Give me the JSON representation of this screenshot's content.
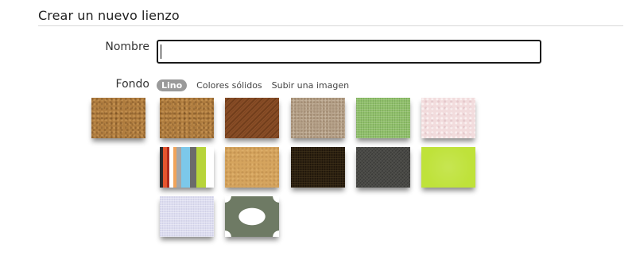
{
  "page": {
    "title": "Crear un nuevo lienzo"
  },
  "form": {
    "name_label": "Nombre",
    "name_value": "",
    "background_label": "Fondo"
  },
  "tabs": [
    {
      "label": "Lino",
      "active": true
    },
    {
      "label": "Colores sólidos",
      "active": false
    },
    {
      "label": "Subir una imagen",
      "active": false
    }
  ],
  "selected_texture": "cork",
  "textures": [
    {
      "name": "cork",
      "color": "#b07d3f"
    },
    {
      "name": "wood-diagonal",
      "color": "#7a4220"
    },
    {
      "name": "sand",
      "color": "#b8a48c"
    },
    {
      "name": "green-fabric",
      "color": "#8fbf6a"
    },
    {
      "name": "pink-paper",
      "color": "#f2dcdd"
    },
    {
      "name": "multicolor-stripes",
      "color": "#7cc8ea"
    },
    {
      "name": "kraft",
      "color": "#d5a45e"
    },
    {
      "name": "dark-brown",
      "color": "#2c2010"
    },
    {
      "name": "dark-gray",
      "color": "#4a4a47"
    },
    {
      "name": "lime",
      "color": "#bfe23a"
    },
    {
      "name": "lavender",
      "color": "#dcdcf0"
    },
    {
      "name": "quatrefoil-pattern",
      "color": "#6e7a64"
    }
  ]
}
